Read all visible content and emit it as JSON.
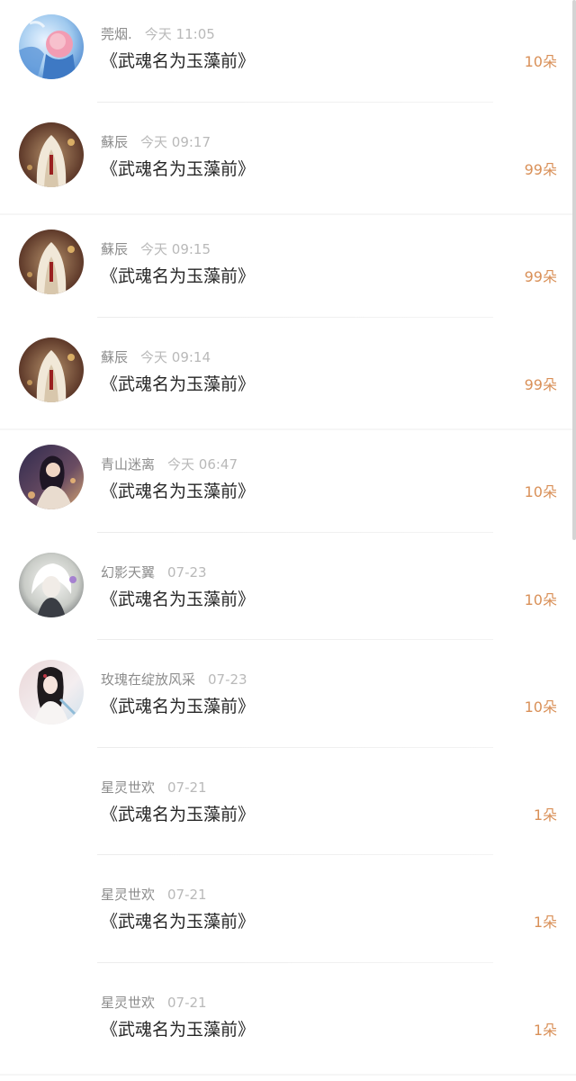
{
  "gift_records": [
    {
      "username": "莞烟.",
      "time": "今天 11:05",
      "message": "《武魂名为玉藻前》",
      "flowers": "10朵",
      "avatar_icon": "avatar-blue-pink-hair",
      "has_avatar": true
    },
    {
      "username": "蘇辰",
      "time": "今天 09:17",
      "message": "《武魂名为玉藻前》",
      "flowers": "99朵",
      "avatar_icon": "avatar-white-hood",
      "has_avatar": true
    },
    {
      "username": "蘇辰",
      "time": "今天 09:15",
      "message": "《武魂名为玉藻前》",
      "flowers": "99朵",
      "avatar_icon": "avatar-white-hood",
      "has_avatar": true
    },
    {
      "username": "蘇辰",
      "time": "今天 09:14",
      "message": "《武魂名为玉藻前》",
      "flowers": "99朵",
      "avatar_icon": "avatar-white-hood",
      "has_avatar": true
    },
    {
      "username": "青山迷离",
      "time": "今天 06:47",
      "message": "《武魂名为玉藻前》",
      "flowers": "10朵",
      "avatar_icon": "avatar-dark-lady",
      "has_avatar": true
    },
    {
      "username": "幻影天翼",
      "time": "07-23",
      "message": "《武魂名为玉藻前》",
      "flowers": "10朵",
      "avatar_icon": "avatar-white-hair",
      "has_avatar": true
    },
    {
      "username": "玫瑰在绽放风采",
      "time": "07-23",
      "message": "《武魂名为玉藻前》",
      "flowers": "10朵",
      "avatar_icon": "avatar-ancient-lady",
      "has_avatar": true
    },
    {
      "username": "星灵世欢",
      "time": "07-21",
      "message": "《武魂名为玉藻前》",
      "flowers": "1朵",
      "avatar_icon": "",
      "has_avatar": false
    },
    {
      "username": "星灵世欢",
      "time": "07-21",
      "message": "《武魂名为玉藻前》",
      "flowers": "1朵",
      "avatar_icon": "",
      "has_avatar": false
    },
    {
      "username": "星灵世欢",
      "time": "07-21",
      "message": "《武魂名为玉藻前》",
      "flowers": "1朵",
      "avatar_icon": "",
      "has_avatar": false
    }
  ],
  "colors": {
    "username": "#8c8c8c",
    "time": "#b9b9b9",
    "message": "#262626",
    "flowers": "#d99058",
    "divider": "#ececec"
  }
}
